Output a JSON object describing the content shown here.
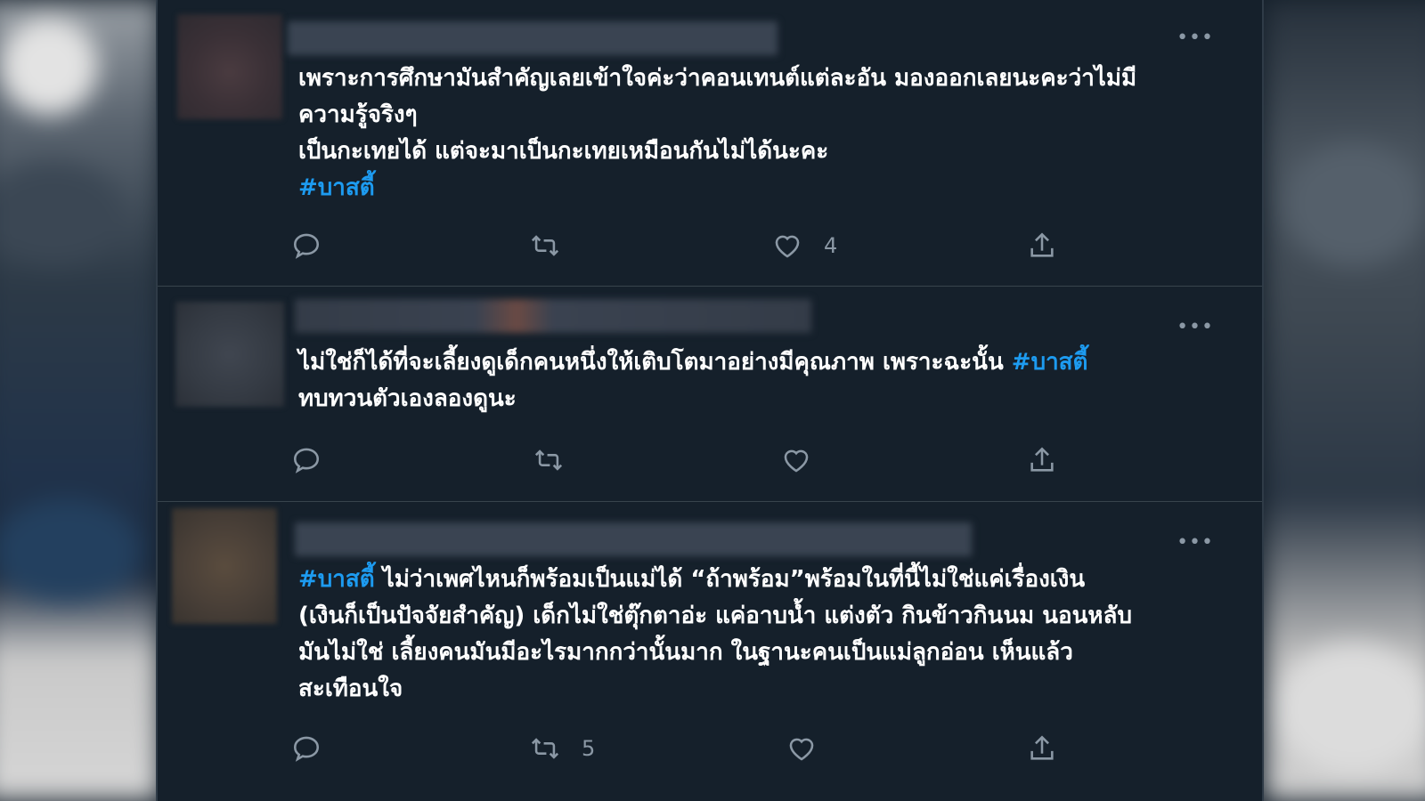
{
  "tweets": [
    {
      "text_lines": [
        "เพราะการศึกษามันสำคัญเลยเข้าใจค่ะว่าคอนเทนต์แต่ละอัน มองออกเลยนะคะว่าไม่มี",
        "ความรู้จริงๆ",
        "เป็นกะเทยได้ แต่จะมาเป็นกะเทยเหมือนกันไม่ได้นะคะ"
      ],
      "hashtag": "#บาสตี้",
      "more_label": "•••",
      "counts": {
        "reply": "",
        "retweet": "",
        "like": "4",
        "share": ""
      }
    },
    {
      "text_line_1": "ไม่ใช่ก็ได้ที่จะเลี้ยงดูเด็กคนหนึ่งให้เติบโตมาอย่างมีคุณภาพ เพราะฉะนั้น ",
      "hashtag": "#บาสตี้",
      "text_line_2": "ทบทวนตัวเองลองดูนะ",
      "more_label": "•••",
      "counts": {
        "reply": "",
        "retweet": "",
        "like": "",
        "share": ""
      }
    },
    {
      "hashtag": "#บาสตี้",
      "text_line_1_rest": " ไม่ว่าเพศไหนก็พร้อมเป็นแม่ได้ “ถ้าพร้อม”พร้อมในที่นี้ไม่ใช่แค่เรื่องเงิน",
      "text_lines_rest": [
        "(เงินก็เป็นปัจจัยสำคัญ) เด็กไม่ใช่ตุ๊กตาอ่ะ แค่อาบน้ำ แต่งตัว กินข้าวกินนม นอนหลับ",
        "มันไม่ใช่ เลี้ยงคนมันมีอะไรมากกว่านั้นมาก ในฐานะคนเป็นแม่ลูกอ่อน เห็นแล้ว",
        "สะเทือนใจ"
      ],
      "more_label": "•••",
      "counts": {
        "reply": "",
        "retweet": "5",
        "like": "",
        "share": ""
      }
    }
  ],
  "icons": {
    "reply": "reply-icon",
    "retweet": "retweet-icon",
    "like": "heart-icon",
    "share": "share-icon",
    "more": "more-icon"
  },
  "colors": {
    "background": "#15202b",
    "text": "#ffffff",
    "hashtag": "#1d9bf0",
    "muted": "#8b98a5",
    "divider": "#38444d"
  }
}
